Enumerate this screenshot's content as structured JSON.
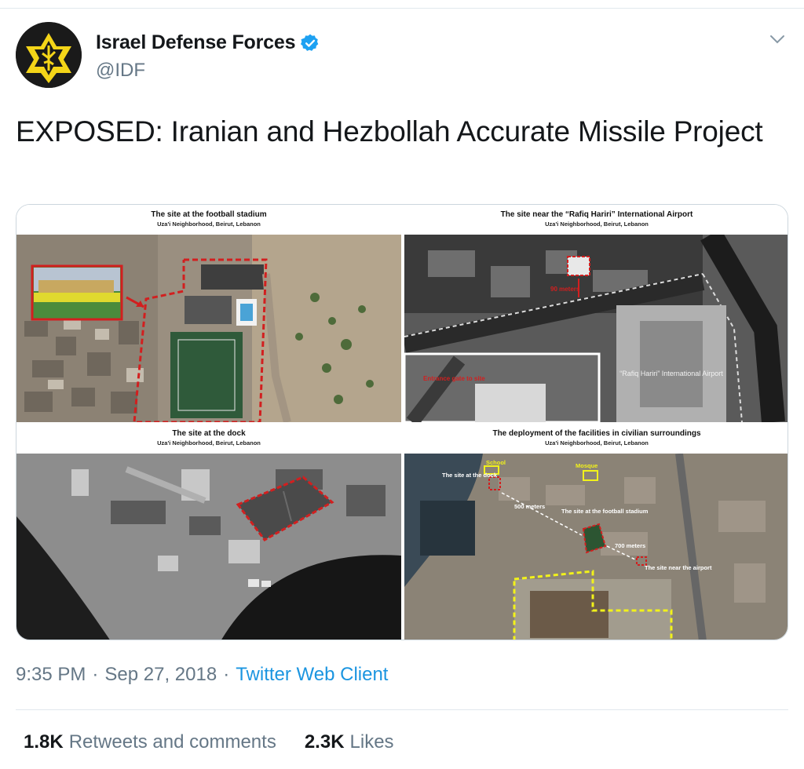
{
  "account": {
    "display_name": "Israel Defense Forces",
    "handle": "@IDF",
    "verified": true,
    "avatar_icon": "idf-emblem-icon"
  },
  "tweet": {
    "text": "EXPOSED: Iranian and Hezbollah Accurate Missile Project"
  },
  "media": {
    "panels": [
      {
        "title": "The site at the football stadium",
        "subtitle": "Uza'i Neighborhood, Beirut, Lebanon"
      },
      {
        "title": "The site near the “Rafiq Hariri” International Airport",
        "subtitle": "Uza'i Neighborhood, Beirut, Lebanon",
        "labels": {
          "distance": "90 meters",
          "airport": "“Rafiq Hariri” International Airport",
          "gate": "Entrance gate to site"
        }
      },
      {
        "title": "The site at the dock",
        "subtitle": "Uza'i Neighborhood, Beirut, Lebanon"
      },
      {
        "title": "The deployment of the facilities in civilian surroundings",
        "subtitle": "Uza'i Neighborhood, Beirut, Lebanon",
        "labels": {
          "school": "School",
          "mosque": "Mosque",
          "dock": "The site at the dock",
          "stadium": "The site at the football stadium",
          "airport": "The site near the airport",
          "dist_500": "500 meters",
          "dist_700": "700 meters"
        }
      }
    ],
    "colors": {
      "marker_red": "#d21f1f",
      "marker_yellow": "#f2f21a"
    }
  },
  "meta": {
    "time": "9:35 PM",
    "separator": "·",
    "date": "Sep 27, 2018",
    "source": "Twitter Web Client"
  },
  "stats": {
    "retweets_count": "1.8K",
    "retweets_label": "Retweets and comments",
    "likes_count": "2.3K",
    "likes_label": "Likes"
  },
  "colors": {
    "link": "#1b95e0",
    "verified": "#1da1f2",
    "secondary_text": "#657786"
  }
}
